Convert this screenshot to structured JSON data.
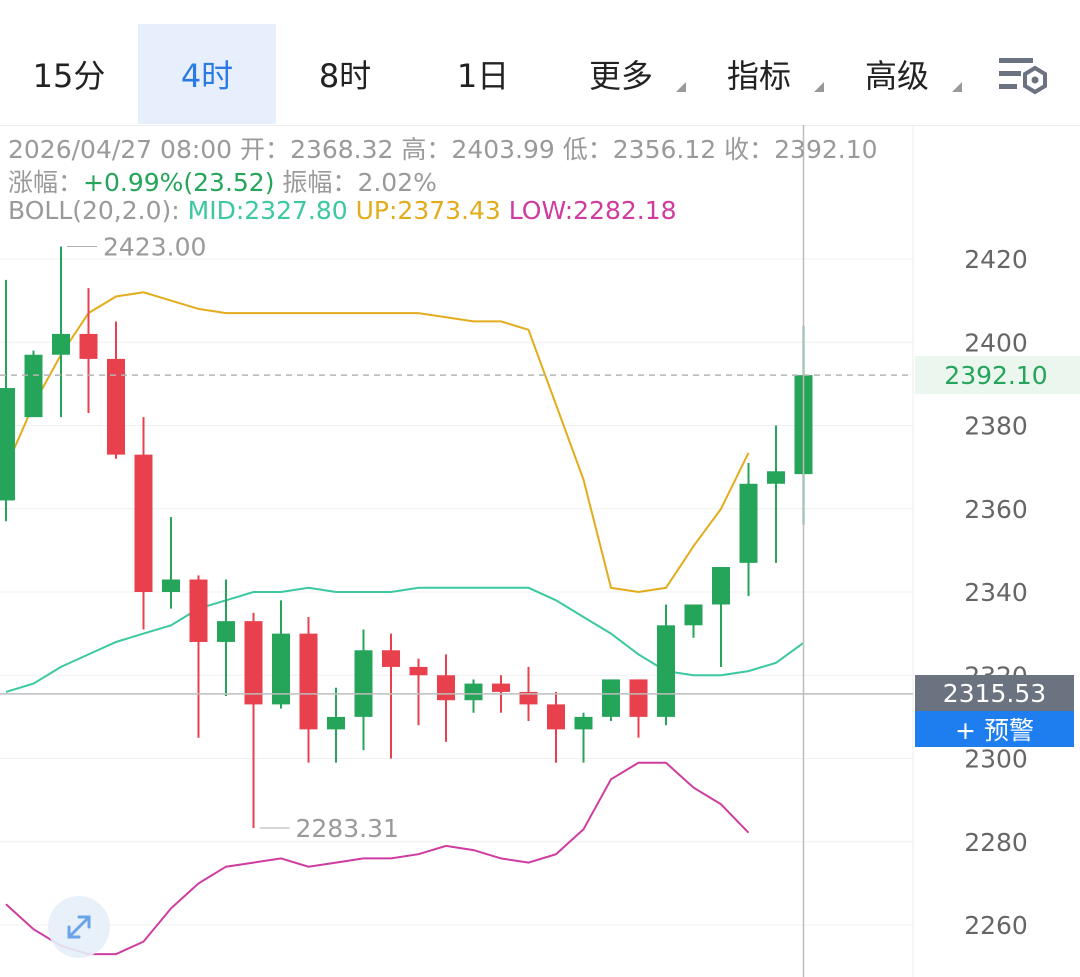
{
  "tabs": [
    {
      "label": "15分",
      "active": false,
      "dropdown": false
    },
    {
      "label": "4时",
      "active": true,
      "dropdown": false
    },
    {
      "label": "8时",
      "active": false,
      "dropdown": false
    },
    {
      "label": "1日",
      "active": false,
      "dropdown": false
    },
    {
      "label": "更多",
      "active": false,
      "dropdown": true
    },
    {
      "label": "指标",
      "active": false,
      "dropdown": true
    },
    {
      "label": "高级",
      "active": false,
      "dropdown": true
    }
  ],
  "settings_icon": "chart-settings-icon",
  "info": {
    "datetime": "2026/04/27 08:00",
    "open_label": "开：",
    "open": "2368.32",
    "high_label": "高：",
    "high": "2403.99",
    "low_label": "低：",
    "low": "2356.12",
    "close_label": "收：",
    "close": "2392.10",
    "change_label": "涨幅：",
    "change": "+0.99%(23.52)",
    "amplitude_label": "振幅：",
    "amplitude": "2.02%",
    "boll_label": "BOLL(20,2.0):",
    "mid_label": "MID:",
    "mid": "2327.80",
    "up_label": "UP:",
    "up": "2373.43",
    "lowb_label": "LOW:",
    "lowb": "2282.18"
  },
  "price_labels": {
    "current": "2392.10",
    "crosshair": "2315.53",
    "alert": "+ 预警"
  },
  "colors": {
    "up": "#25a55a",
    "down": "#e8404d",
    "mid": "#3cc8a0",
    "upper": "#e3ac1c",
    "lower": "#cf3ca0",
    "axis_text": "#666666"
  },
  "chart_data": {
    "type": "candlestick",
    "title": "",
    "y_ticks": [
      2260,
      2280,
      2300,
      2320,
      2340,
      2360,
      2380,
      2400,
      2420
    ],
    "ylim": [
      2256,
      2425
    ],
    "max_label": "2423.00",
    "min_label": "2283.31",
    "current_price": 2392.1,
    "crosshair_price": 2315.53,
    "candles": [
      {
        "o": 2362,
        "h": 2415,
        "l": 2357,
        "c": 2389
      },
      {
        "o": 2382,
        "h": 2398,
        "l": 2384,
        "c": 2397
      },
      {
        "o": 2397,
        "h": 2423,
        "l": 2382,
        "c": 2402
      },
      {
        "o": 2402,
        "h": 2413,
        "l": 2383,
        "c": 2396
      },
      {
        "o": 2396,
        "h": 2405,
        "l": 2372,
        "c": 2373
      },
      {
        "o": 2373,
        "h": 2382,
        "l": 2331,
        "c": 2340
      },
      {
        "o": 2340,
        "h": 2358,
        "l": 2336,
        "c": 2343
      },
      {
        "o": 2343,
        "h": 2344,
        "l": 2305,
        "c": 2328
      },
      {
        "o": 2328,
        "h": 2343,
        "l": 2315,
        "c": 2333
      },
      {
        "o": 2333,
        "h": 2335,
        "l": 2283.31,
        "c": 2313
      },
      {
        "o": 2313,
        "h": 2338,
        "l": 2312,
        "c": 2330
      },
      {
        "o": 2330,
        "h": 2334,
        "l": 2299,
        "c": 2307
      },
      {
        "o": 2307,
        "h": 2317,
        "l": 2299,
        "c": 2310
      },
      {
        "o": 2310,
        "h": 2331,
        "l": 2302,
        "c": 2326
      },
      {
        "o": 2326,
        "h": 2330,
        "l": 2300,
        "c": 2322
      },
      {
        "o": 2322,
        "h": 2324,
        "l": 2308,
        "c": 2320
      },
      {
        "o": 2320,
        "h": 2325,
        "l": 2304,
        "c": 2314
      },
      {
        "o": 2314,
        "h": 2319,
        "l": 2311,
        "c": 2318
      },
      {
        "o": 2318,
        "h": 2320,
        "l": 2311,
        "c": 2316
      },
      {
        "o": 2316,
        "h": 2322,
        "l": 2309,
        "c": 2313
      },
      {
        "o": 2313,
        "h": 2316,
        "l": 2299,
        "c": 2307
      },
      {
        "o": 2307,
        "h": 2311,
        "l": 2299,
        "c": 2310
      },
      {
        "o": 2310,
        "h": 2319,
        "l": 2309,
        "c": 2319
      },
      {
        "o": 2319,
        "h": 2319,
        "l": 2305,
        "c": 2310
      },
      {
        "o": 2310,
        "h": 2337,
        "l": 2308,
        "c": 2332
      },
      {
        "o": 2332,
        "h": 2337,
        "l": 2329,
        "c": 2337
      },
      {
        "o": 2337,
        "h": 2343,
        "l": 2322,
        "c": 2346
      },
      {
        "o": 2347,
        "h": 2371,
        "l": 2339,
        "c": 2366
      },
      {
        "o": 2366,
        "h": 2380,
        "l": 2347,
        "c": 2369
      },
      {
        "o": 2368.32,
        "h": 2403.99,
        "l": 2356.12,
        "c": 2392.1
      }
    ],
    "boll_mid": [
      2316,
      2318,
      2322,
      2325,
      2328,
      2330,
      2332,
      2336,
      2338,
      2340,
      2340,
      2341,
      2340,
      2340,
      2340,
      2341,
      2341,
      2341,
      2341,
      2341,
      2338,
      2334,
      2330,
      2325,
      2321,
      2320,
      2320,
      2321,
      2323,
      2327.8
    ],
    "boll_up": [
      2370,
      2385,
      2397,
      2407,
      2411,
      2412,
      2410,
      2408,
      2407,
      2407,
      2407,
      2407,
      2407,
      2407,
      2407,
      2407,
      2406,
      2405,
      2405,
      2403,
      2385,
      2367,
      2341,
      2340,
      2341,
      2351,
      2360,
      2373.43
    ],
    "boll_low": [
      2265,
      2259,
      2255,
      2253,
      2253,
      2256,
      2264,
      2270,
      2274,
      2275,
      2276,
      2274,
      2275,
      2276,
      2276,
      2277,
      2279,
      2278,
      2276,
      2275,
      2277,
      2283,
      2295,
      2299,
      2299,
      2293,
      2289,
      2282.18
    ],
    "boll_x_start": 0
  }
}
